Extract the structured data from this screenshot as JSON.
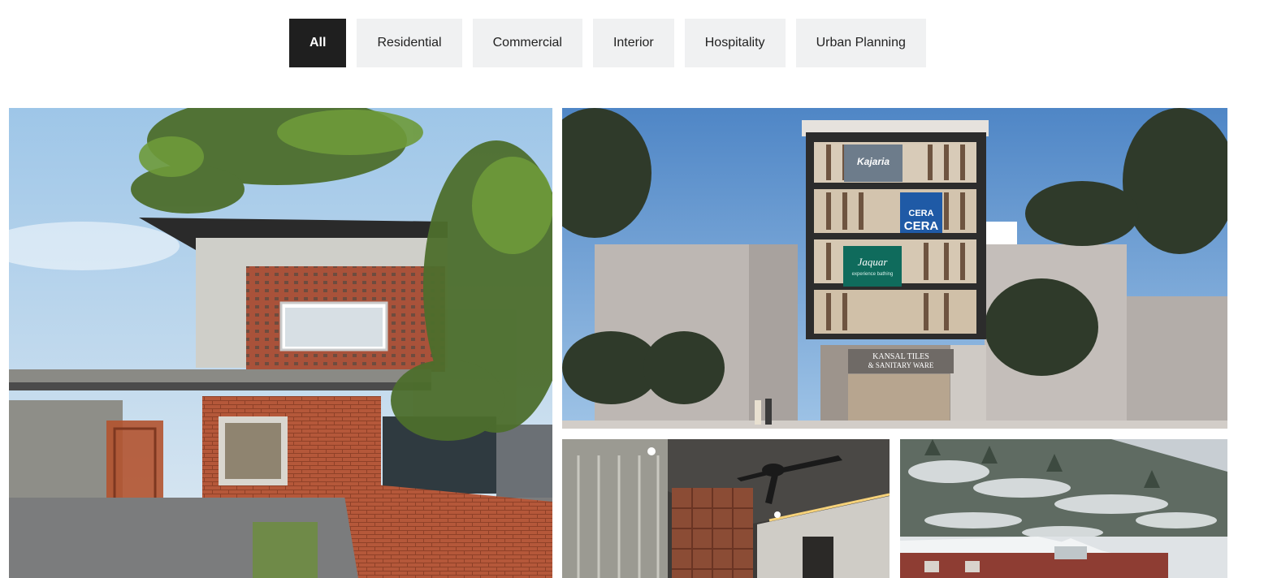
{
  "filters": [
    {
      "label": "All",
      "active": true
    },
    {
      "label": "Residential",
      "active": false
    },
    {
      "label": "Commercial",
      "active": false
    },
    {
      "label": "Interior",
      "active": false
    },
    {
      "label": "Hospitality",
      "active": false
    },
    {
      "label": "Urban Planning",
      "active": false
    }
  ],
  "commercial_signage": {
    "brand_1": "Kajaria",
    "brand_2_top": "CERA",
    "brand_2_bottom": "CERA",
    "brand_3": "Jaquar",
    "brand_3_tagline": "experience bathing",
    "shop_line_1": "KANSAL TILES",
    "shop_line_2": "& SANITARY WARE"
  },
  "colors": {
    "active_bg": "#1f1f1f",
    "inactive_bg": "#f0f1f2",
    "brick": "#b5583a"
  }
}
